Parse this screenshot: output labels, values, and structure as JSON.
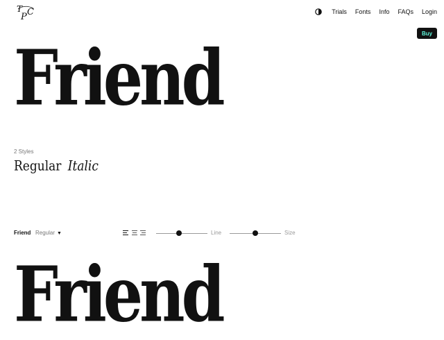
{
  "header": {
    "logo_icon": "tpc-monogram-icon",
    "theme_icon": "contrast-toggle-icon",
    "nav": [
      {
        "label": "Trials"
      },
      {
        "label": "Fonts"
      },
      {
        "label": "Info"
      },
      {
        "label": "FAQs"
      },
      {
        "label": "Login"
      }
    ],
    "buy_label": "Buy",
    "buy_text_color": "#5ef3d8",
    "buy_bg_color": "#111111"
  },
  "hero": {
    "title": "Friend"
  },
  "styles": {
    "count_label": "2 Styles",
    "list": [
      "Regular",
      "Italic"
    ]
  },
  "toolbar": {
    "font_name": "Friend",
    "style_select": "Regular",
    "caret_icon": "caret-down-icon",
    "align_icons": [
      "align-left-icon",
      "align-center-icon",
      "align-right-icon"
    ],
    "line_label": "Line",
    "line_value": 0.44,
    "size_label": "Size",
    "size_value": 0.5
  },
  "sample": {
    "text": "Friend"
  }
}
